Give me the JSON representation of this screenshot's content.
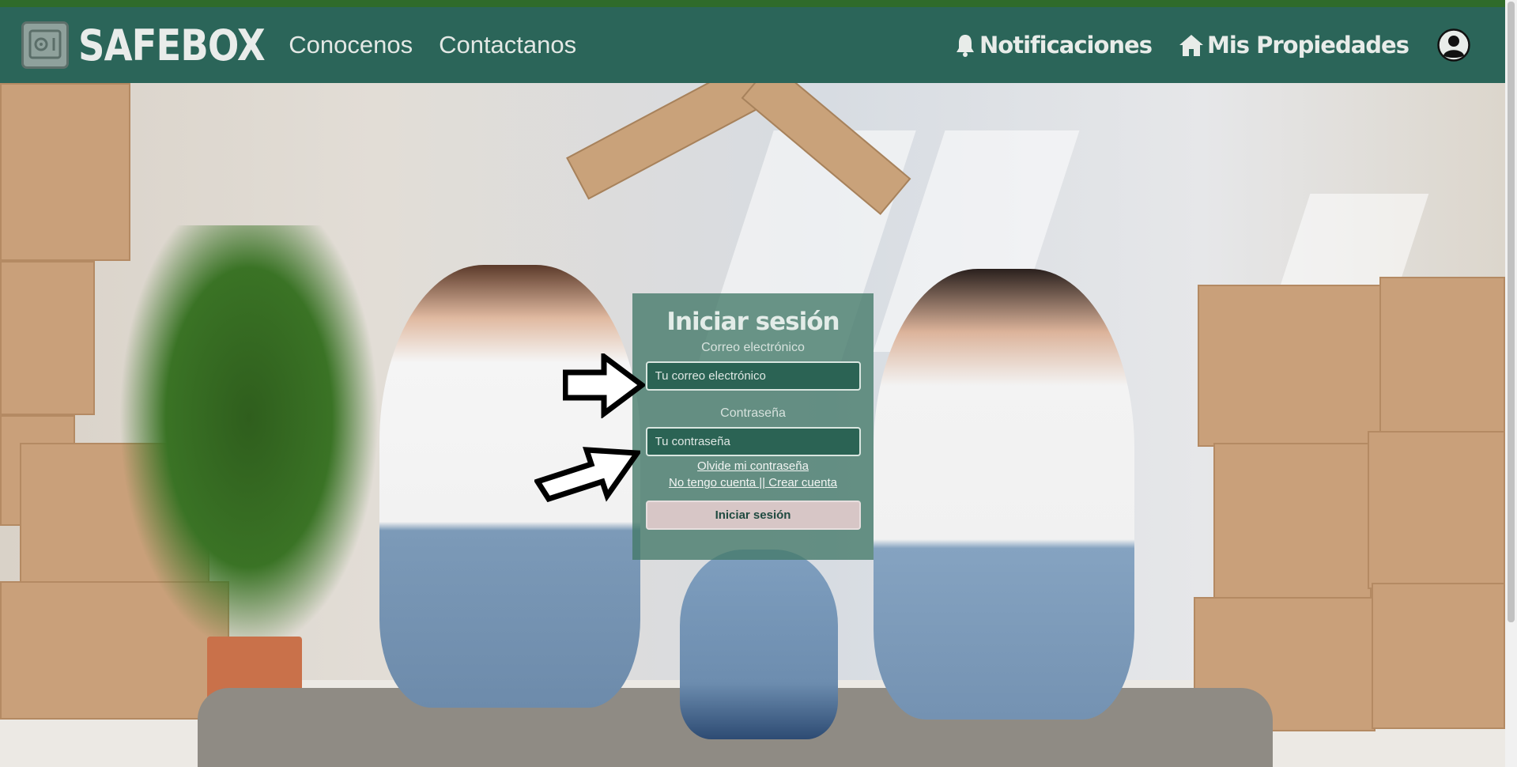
{
  "brand": {
    "name": "SAFEBOX"
  },
  "nav": {
    "links": [
      "Conocenos",
      "Contactanos"
    ],
    "notifications_label": "Notificaciones",
    "properties_label": "Mis Propiedades"
  },
  "login": {
    "title": "Iniciar sesión",
    "email_label": "Correo electrónico",
    "email_placeholder": "Tu correo electrónico",
    "password_label": "Contraseña",
    "password_placeholder": "Tu contraseña",
    "forgot_link": "Olvide mi contraseña",
    "register_link": "No tengo cuenta || Crear cuenta",
    "submit_label": "Iniciar sesión"
  },
  "colors": {
    "navbar": "#2b6559",
    "card": "#427868",
    "input_bg": "#2b6354",
    "submit_bg": "#d7c6c6"
  },
  "icons": [
    "safe-logo-icon",
    "bell-icon",
    "house-icon",
    "user-circle-icon",
    "arrow-right-icon"
  ]
}
